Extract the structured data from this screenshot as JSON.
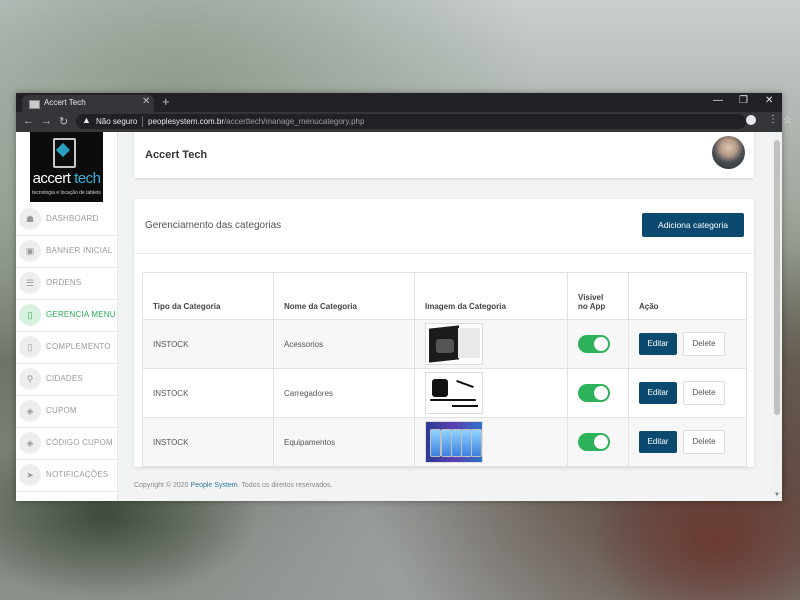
{
  "browser": {
    "tab_title": "Accert Tech",
    "tab_close": "✕",
    "new_tab": "+",
    "security_label": "Não seguro",
    "url_host": "peoplesystem.com.br",
    "url_path": "/accerttech/manage_menucategory.php"
  },
  "logo": {
    "brand_white": "accert ",
    "brand_blue": "tech",
    "tagline": "tecnologia e locação de tablets"
  },
  "sidebar": {
    "items": [
      {
        "label": "DASHBOARD",
        "icon": "dashboard-icon",
        "glyph": "☗"
      },
      {
        "label": "BANNER INICIAL",
        "icon": "image-icon",
        "glyph": "▣"
      },
      {
        "label": "ORDENS",
        "icon": "list-icon",
        "glyph": "☰"
      },
      {
        "label": "GERENCIA MENU",
        "icon": "tablet-icon",
        "glyph": "▯",
        "active": true
      },
      {
        "label": "COMPLEMENTO",
        "icon": "tablet-icon",
        "glyph": "▯"
      },
      {
        "label": "CIDADES",
        "icon": "location-icon",
        "glyph": "⚲"
      },
      {
        "label": "CUPOM",
        "icon": "tag-icon",
        "glyph": "◈"
      },
      {
        "label": "CÓDIGO CUPOM",
        "icon": "tag-icon",
        "glyph": "◈"
      },
      {
        "label": "NOTIFICAÇÕES",
        "icon": "send-icon",
        "glyph": "➤"
      }
    ]
  },
  "header": {
    "title": "Accert Tech"
  },
  "main": {
    "title": "Gerenciamento das categorias",
    "add_button": "Adiciona categoria",
    "columns": {
      "tipo": "Tipo da Categoria",
      "nome": "Nome da Categoria",
      "imagem": "Imagem da Categoria",
      "visivel_1": "Visível",
      "visivel_2": "no App",
      "acao": "Ação"
    },
    "rows": [
      {
        "tipo": "INSTOCK",
        "nome": "Acessorios",
        "image": "accessories-image",
        "visible": true
      },
      {
        "tipo": "INSTOCK",
        "nome": "Carregadores",
        "image": "chargers-image",
        "visible": true
      },
      {
        "tipo": "INSTOCK",
        "nome": "Equipamentos",
        "image": "devices-image",
        "visible": true
      }
    ],
    "edit_label": "Editar",
    "delete_label": "Delete"
  },
  "footer": {
    "prefix": "Copyright © 2020 ",
    "link": "People System",
    "suffix": ". Todos os direitos reservados."
  },
  "colors": {
    "primary": "#0b4a6e",
    "active_green": "#2bab54",
    "toggle_on": "#2db159"
  }
}
